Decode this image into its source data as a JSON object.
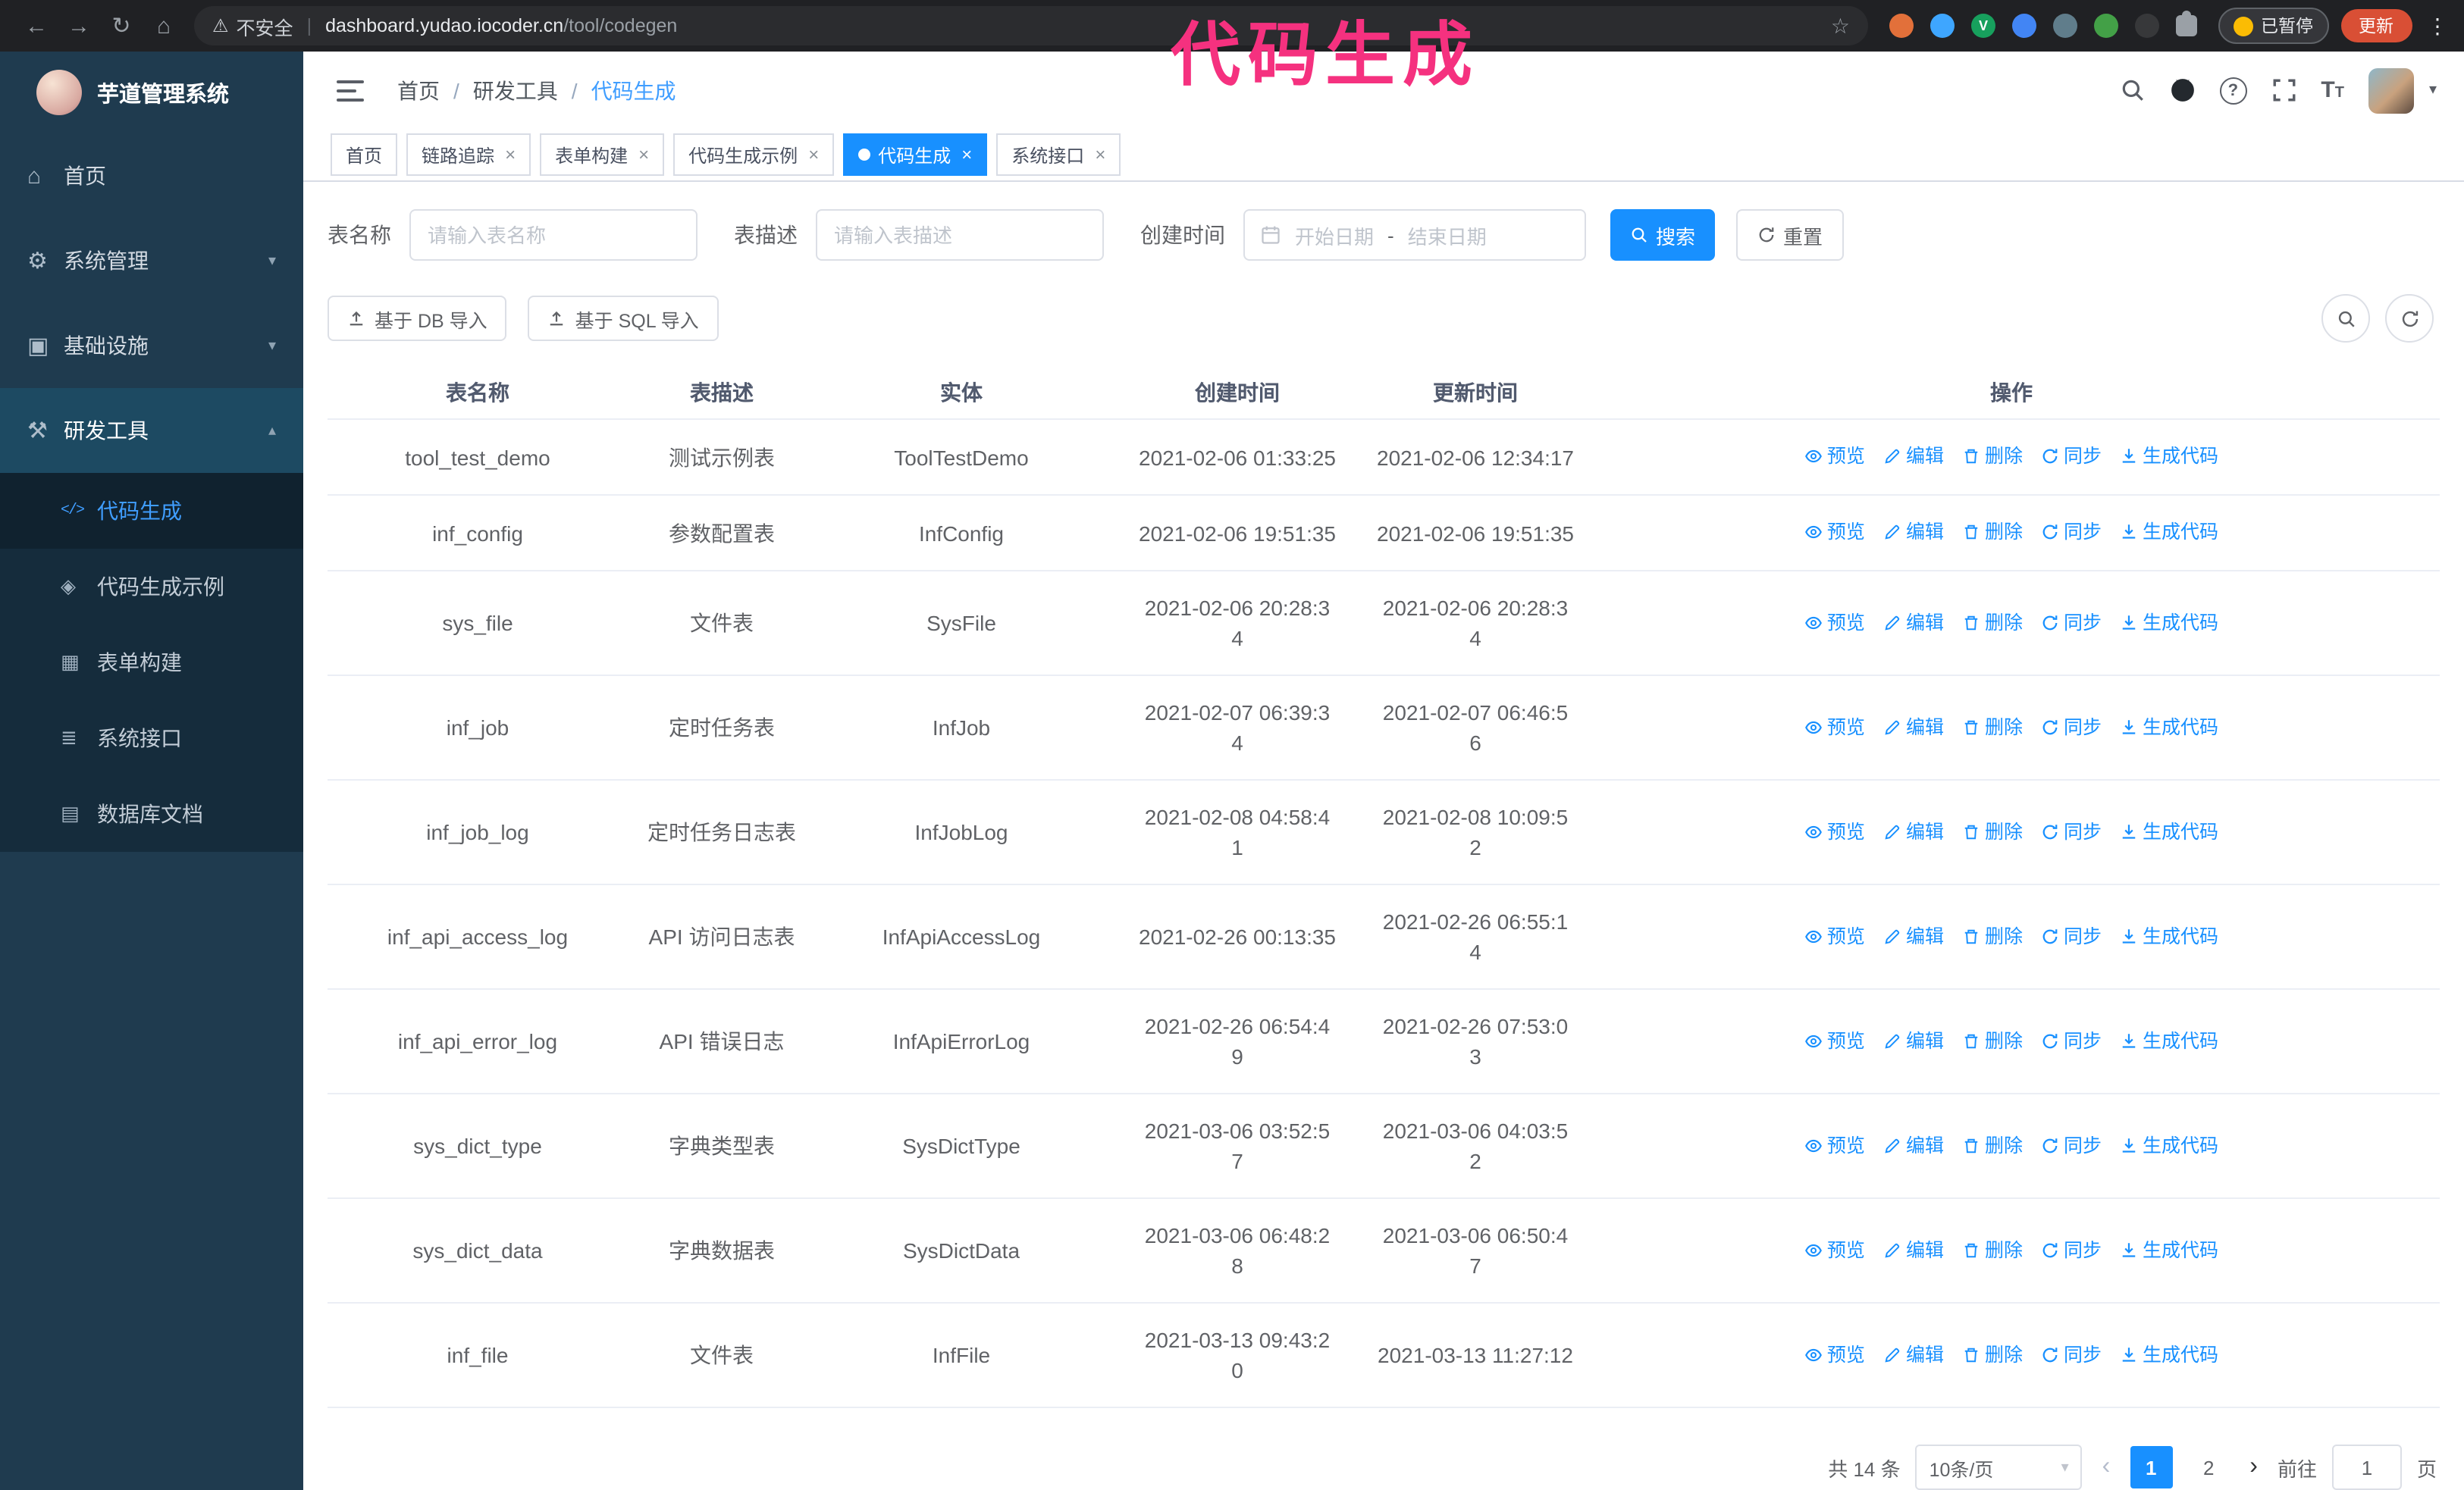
{
  "colors": {
    "accent": "#1890ff",
    "active_blue": "#409eff",
    "annotation": "#f5317f",
    "sidebar_bg": "#1f3b4f",
    "sidebar_submenu_bg": "#152c3c",
    "update_button_bg": "#d94f35"
  },
  "browser": {
    "security_label": "不安全",
    "url_host": "dashboard.yudao.iocoder.cn",
    "url_path": "/tool/codegen",
    "paused_badge": "已暂停",
    "update_button": "更新"
  },
  "annotation": {
    "text": "代码生成"
  },
  "sidebar": {
    "logo_title": "芋道管理系统",
    "items": [
      {
        "label": "首页",
        "icon": "home-icon"
      },
      {
        "label": "系统管理",
        "icon": "gear-icon"
      },
      {
        "label": "基础设施",
        "icon": "infrastructure-icon"
      },
      {
        "label": "研发工具",
        "icon": "dev-tools-icon"
      }
    ],
    "sub_items": [
      {
        "label": "代码生成",
        "icon": "code-icon",
        "active": true
      },
      {
        "label": "代码生成示例",
        "icon": "example-icon"
      },
      {
        "label": "表单构建",
        "icon": "form-builder-icon"
      },
      {
        "label": "系统接口",
        "icon": "api-icon"
      },
      {
        "label": "数据库文档",
        "icon": "database-doc-icon"
      }
    ]
  },
  "breadcrumb": {
    "items": [
      "首页",
      "研发工具",
      "代码生成"
    ]
  },
  "tabs": [
    {
      "label": "首页",
      "closable": false,
      "active": false
    },
    {
      "label": "链路追踪",
      "closable": true,
      "active": false
    },
    {
      "label": "表单构建",
      "closable": true,
      "active": false
    },
    {
      "label": "代码生成示例",
      "closable": true,
      "active": false
    },
    {
      "label": "代码生成",
      "closable": true,
      "active": true
    },
    {
      "label": "系统接口",
      "closable": true,
      "active": false
    }
  ],
  "filters": {
    "name_label": "表名称",
    "name_placeholder": "请输入表名称",
    "desc_label": "表描述",
    "desc_placeholder": "请输入表描述",
    "time_label": "创建时间",
    "start_placeholder": "开始日期",
    "range_separator": "-",
    "end_placeholder": "结束日期",
    "search_button": "搜索",
    "reset_button": "重置"
  },
  "toolbar": {
    "import_db_button": "基于 DB 导入",
    "import_sql_button": "基于 SQL 导入"
  },
  "table": {
    "headers": [
      "表名称",
      "表描述",
      "实体",
      "创建时间",
      "更新时间",
      "操作"
    ],
    "actions": [
      "预览",
      "编辑",
      "删除",
      "同步",
      "生成代码"
    ],
    "rows": [
      {
        "name": "tool_test_demo",
        "desc": "测试示例表",
        "entity": "ToolTestDemo",
        "created": "2021-02-06 01:33:25",
        "updated": "2021-02-06 12:34:17"
      },
      {
        "name": "inf_config",
        "desc": "参数配置表",
        "entity": "InfConfig",
        "created": "2021-02-06 19:51:35",
        "updated": "2021-02-06 19:51:35"
      },
      {
        "name": "sys_file",
        "desc": "文件表",
        "entity": "SysFile",
        "created": "2021-02-06 20:28:3\n4",
        "updated": "2021-02-06 20:28:3\n4"
      },
      {
        "name": "inf_job",
        "desc": "定时任务表",
        "entity": "InfJob",
        "created": "2021-02-07 06:39:3\n4",
        "updated": "2021-02-07 06:46:5\n6"
      },
      {
        "name": "inf_job_log",
        "desc": "定时任务日志表",
        "entity": "InfJobLog",
        "created": "2021-02-08 04:58:4\n1",
        "updated": "2021-02-08 10:09:5\n2"
      },
      {
        "name": "inf_api_access_log",
        "desc": "API 访问日志表",
        "entity": "InfApiAccessLog",
        "created": "2021-02-26 00:13:35",
        "updated": "2021-02-26 06:55:1\n4"
      },
      {
        "name": "inf_api_error_log",
        "desc": "API 错误日志",
        "entity": "InfApiErrorLog",
        "created": "2021-02-26 06:54:4\n9",
        "updated": "2021-02-26 07:53:0\n3"
      },
      {
        "name": "sys_dict_type",
        "desc": "字典类型表",
        "entity": "SysDictType",
        "created": "2021-03-06 03:52:5\n7",
        "updated": "2021-03-06 04:03:5\n2"
      },
      {
        "name": "sys_dict_data",
        "desc": "字典数据表",
        "entity": "SysDictData",
        "created": "2021-03-06 06:48:2\n8",
        "updated": "2021-03-06 06:50:4\n7"
      },
      {
        "name": "inf_file",
        "desc": "文件表",
        "entity": "InfFile",
        "created": "2021-03-13 09:43:2\n0",
        "updated": "2021-03-13 11:27:12"
      }
    ]
  },
  "pagination": {
    "total_text": "共 14 条",
    "page_size": "10条/页",
    "pages": [
      "1",
      "2"
    ],
    "active_page": "1",
    "goto_label": "前往",
    "goto_value": "1",
    "goto_unit": "页"
  }
}
